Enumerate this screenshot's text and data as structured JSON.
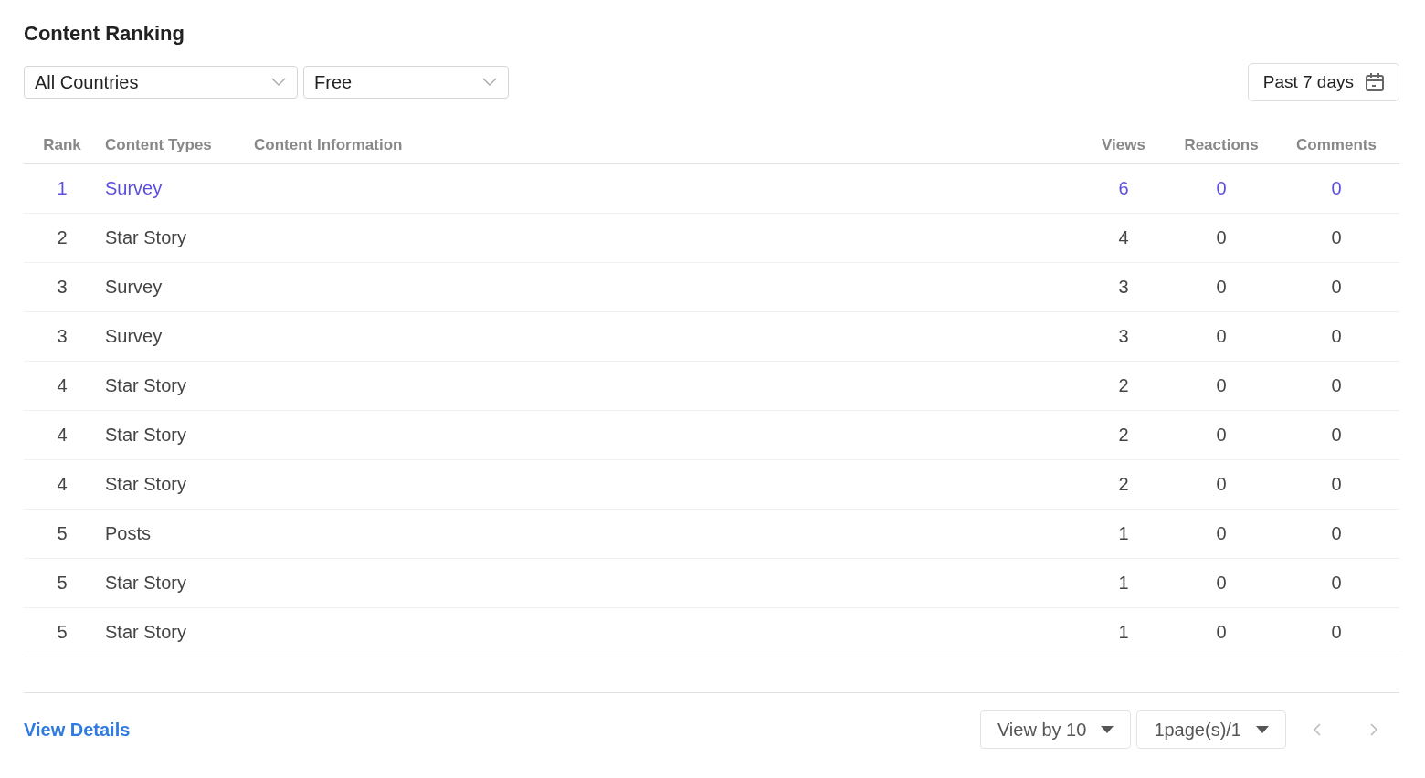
{
  "title": "Content Ranking",
  "filters": [
    {
      "value": "All Countries"
    },
    {
      "value": "Free"
    }
  ],
  "date_range": {
    "label": "Past 7 days"
  },
  "table": {
    "columns": [
      "Rank",
      "Content Types",
      "Content Information",
      "Views",
      "Reactions",
      "Comments"
    ],
    "rows": [
      {
        "rank": "1",
        "type": "Survey",
        "views": "6",
        "reactions": "0",
        "comments": "0",
        "selected": true
      },
      {
        "rank": "2",
        "type": "Star Story",
        "views": "4",
        "reactions": "0",
        "comments": "0",
        "selected": false
      },
      {
        "rank": "3",
        "type": "Survey",
        "views": "3",
        "reactions": "0",
        "comments": "0",
        "selected": false
      },
      {
        "rank": "3",
        "type": "Survey",
        "views": "3",
        "reactions": "0",
        "comments": "0",
        "selected": false
      },
      {
        "rank": "4",
        "type": "Star Story",
        "views": "2",
        "reactions": "0",
        "comments": "0",
        "selected": false
      },
      {
        "rank": "4",
        "type": "Star Story",
        "views": "2",
        "reactions": "0",
        "comments": "0",
        "selected": false
      },
      {
        "rank": "4",
        "type": "Star Story",
        "views": "2",
        "reactions": "0",
        "comments": "0",
        "selected": false
      },
      {
        "rank": "5",
        "type": "Posts",
        "views": "1",
        "reactions": "0",
        "comments": "0",
        "selected": false
      },
      {
        "rank": "5",
        "type": "Star Story",
        "views": "1",
        "reactions": "0",
        "comments": "0",
        "selected": false
      },
      {
        "rank": "5",
        "type": "Star Story",
        "views": "1",
        "reactions": "0",
        "comments": "0",
        "selected": false
      }
    ]
  },
  "footer": {
    "link": "View Details",
    "page_size": "View by 10",
    "page": "1page(s)/1",
    "prev": {
      "disabled": true
    },
    "next": {
      "disabled": true
    }
  }
}
